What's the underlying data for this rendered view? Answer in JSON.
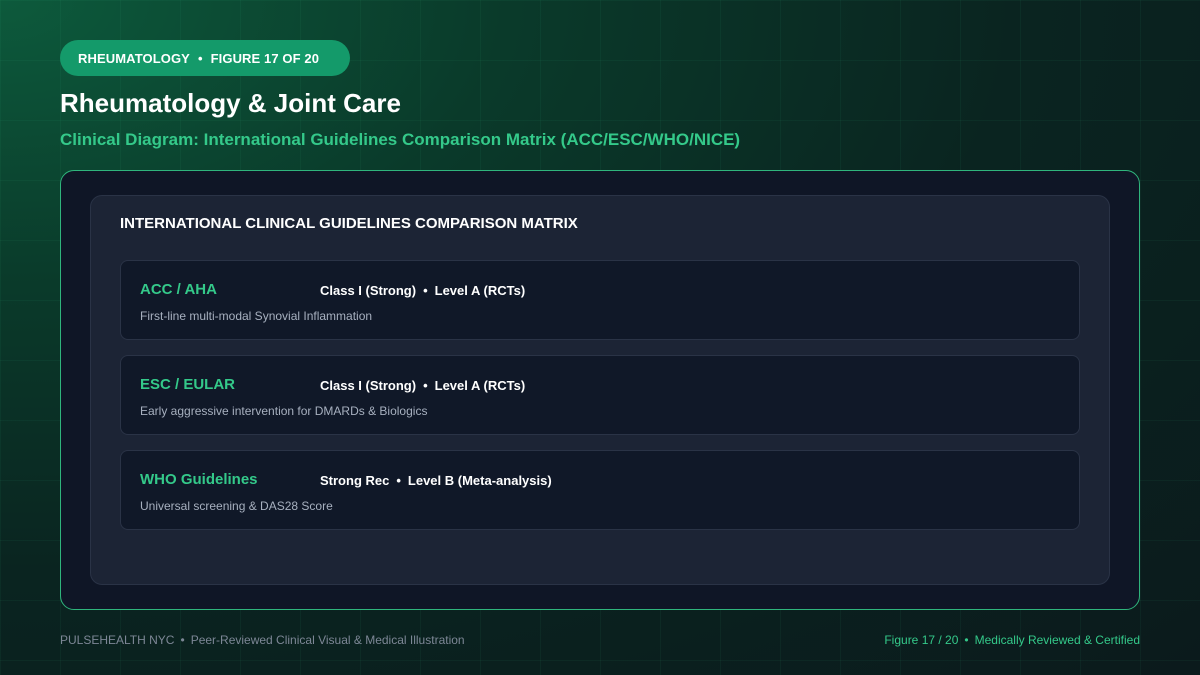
{
  "badge": {
    "category": "RHEUMATOLOGY",
    "separator": "•",
    "figure": "FIGURE 17 OF 20"
  },
  "header": {
    "title": "Rheumatology & Joint Care",
    "subtitle": "Clinical Diagram: International Guidelines Comparison Matrix (ACC/ESC/WHO/NICE)"
  },
  "matrix": {
    "title": "INTERNATIONAL CLINICAL GUIDELINES COMPARISON MATRIX",
    "rows": [
      {
        "org": "ACC / AHA",
        "strength": "Class I (Strong)",
        "separator": "•",
        "level": "Level A (RCTs)",
        "description": "First-line multi-modal Synovial Inflammation"
      },
      {
        "org": "ESC / EULAR",
        "strength": "Class I (Strong)",
        "separator": "•",
        "level": "Level A (RCTs)",
        "description": "Early aggressive intervention for DMARDs & Biologics"
      },
      {
        "org": "WHO Guidelines",
        "strength": "Strong Rec",
        "separator": "•",
        "level": "Level B (Meta-analysis)",
        "description": "Universal screening & DAS28 Score"
      }
    ]
  },
  "footer": {
    "brand": "PULSEHEALTH NYC",
    "separator": "•",
    "tagline": "Peer-Reviewed Clinical Visual & Medical Illustration",
    "figure": "Figure 17 / 20",
    "certification": "Medically Reviewed & Certified"
  },
  "colors": {
    "accent": "#34c98a",
    "badge": "#149a6a",
    "panel_border": "#2fb57c",
    "background": "#0b1a1c"
  }
}
